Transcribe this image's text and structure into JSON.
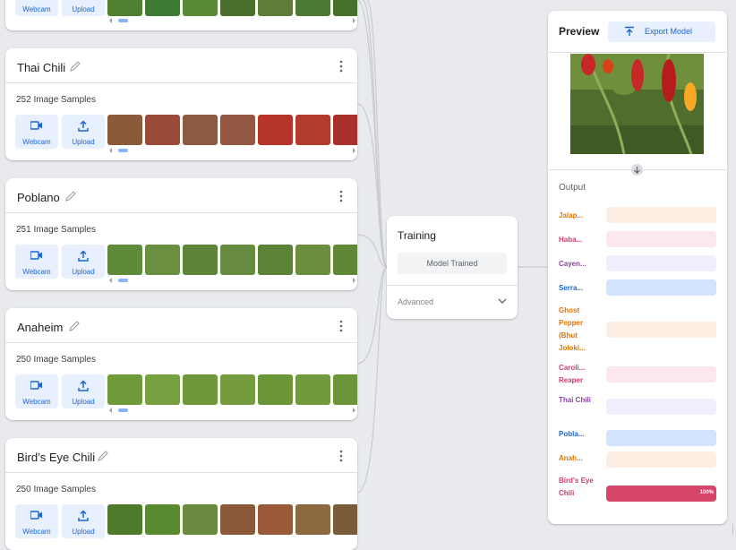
{
  "classes": [
    {
      "name": "",
      "samples": "",
      "thumb_colors": [
        "#4f7f2f",
        "#3f7a34",
        "#5a8a35",
        "#4a6f2c",
        "#5e7d38",
        "#4d7a32",
        "#45702c"
      ]
    },
    {
      "name": "Thai Chili",
      "samples": "252 Image Samples",
      "thumb_colors": [
        "#8a5a3a",
        "#9a4a38",
        "#8c5a40",
        "#925844",
        "#b7342a",
        "#b33b2d",
        "#a8302a"
      ]
    },
    {
      "name": "Poblano",
      "samples": "251 Image Samples",
      "thumb_colors": [
        "#5e8a3a",
        "#6b8f40",
        "#5d8538",
        "#668a3e",
        "#5a8336",
        "#6a8d3f",
        "#5e8838"
      ]
    },
    {
      "name": "Anaheim",
      "samples": "250 Image Samples",
      "thumb_colors": [
        "#6f9a3a",
        "#77a040",
        "#6e983a",
        "#749c3e",
        "#6b9638",
        "#719a3c",
        "#6c9539"
      ]
    },
    {
      "name": "Bird’s Eye Chili",
      "samples": "250 Image Samples",
      "thumb_colors": [
        "#4e7a2c",
        "#5a8a30",
        "#6a8a40",
        "#8a5a3a",
        "#9a5a38",
        "#8c6a40",
        "#7a5a38"
      ]
    }
  ],
  "buttons": {
    "webcam": "Webcam",
    "upload": "Upload"
  },
  "icons": {
    "edit": "pencil-icon",
    "menu": "more-vert-icon",
    "webcam": "videocam-icon",
    "upload": "upload-icon",
    "export": "export-icon",
    "expand": "chevron-down-icon",
    "arrow": "arrow-down-icon"
  },
  "training": {
    "title": "Training",
    "status": "Model Trained",
    "advanced": "Advanced"
  },
  "preview": {
    "title": "Preview",
    "export_label": "Export Model",
    "output_title": "Output"
  },
  "outputs": [
    {
      "label": "Jalap...",
      "color": "#e37400",
      "bg": "#fdeee4",
      "value": 0
    },
    {
      "label": "Haba...",
      "color": "#d13b6c",
      "bg": "#fce8ec",
      "value": 0
    },
    {
      "label": "Cayen...",
      "color": "#8e44ad",
      "bg": "#f0eefc",
      "value": 0
    },
    {
      "label": "Serra...",
      "color": "#1967d2",
      "bg": "#d2e3fc",
      "value": 0
    },
    {
      "label": "Ghost Pepper (Bhut Joloki...",
      "color": "#e37400",
      "bg": "#fdeee4",
      "value": 0
    },
    {
      "label": "Caroli... Reaper",
      "color": "#d13b6c",
      "bg": "#fce8ec",
      "value": 0
    },
    {
      "label": "Thai Chili",
      "color": "#8e44ad",
      "bg": "#f0eefc",
      "value": 0
    },
    {
      "label": "Pobla...",
      "color": "#1967d2",
      "bg": "#d2e3fc",
      "value": 0
    },
    {
      "label": "Anah...",
      "color": "#e37400",
      "bg": "#fdeee4",
      "value": 0
    },
    {
      "label": "Bird's Eye Chili",
      "color": "#d13b6c",
      "bg": "#fce8ec",
      "value": 1.0,
      "fill": "#d7466a",
      "percent_text": "100%"
    }
  ]
}
